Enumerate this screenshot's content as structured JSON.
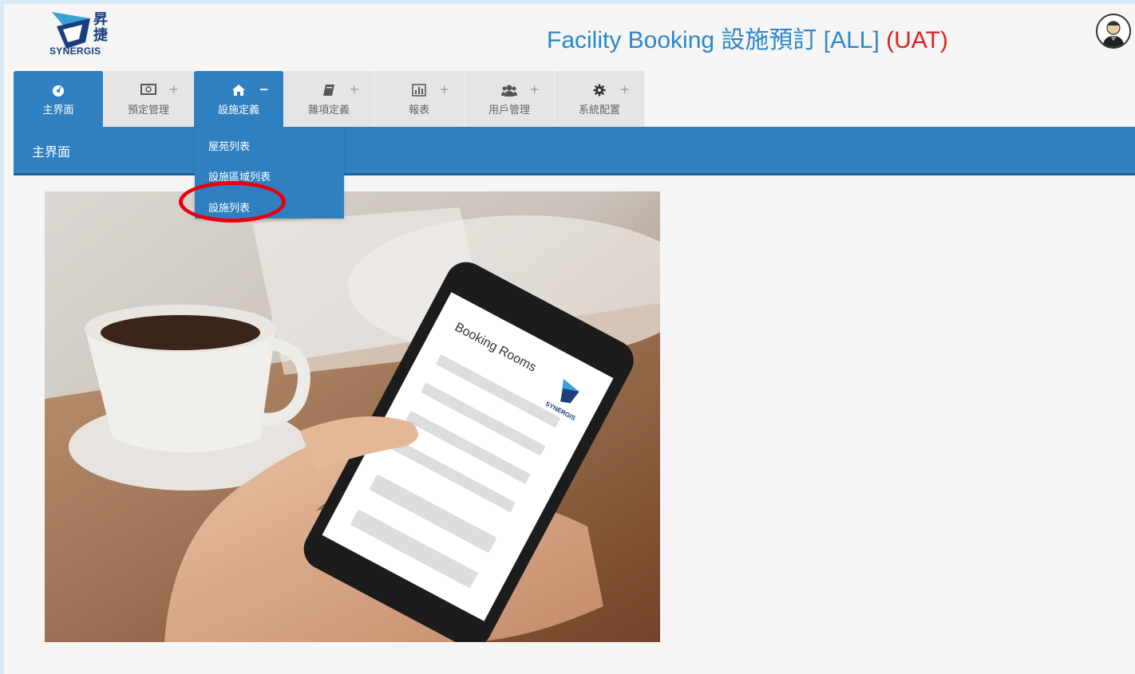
{
  "header": {
    "logo_cn": "昇捷",
    "logo_text": "SYNERGIS",
    "title_main": "Facility Booking 設施預訂 [ALL] ",
    "title_env": "(UAT)",
    "avatar_icon": "user-avatar-icon"
  },
  "tabs": [
    {
      "label": "主界面",
      "icon": "dashboard-icon",
      "toggle": "",
      "active": true
    },
    {
      "label": "預定管理",
      "icon": "money-icon",
      "toggle": "+",
      "active": false
    },
    {
      "label": "設施定義",
      "icon": "home-icon",
      "toggle": "−",
      "active": true
    },
    {
      "label": "雜項定義",
      "icon": "book-icon",
      "toggle": "+",
      "active": false
    },
    {
      "label": "報表",
      "icon": "bar-chart-icon",
      "toggle": "+",
      "active": false
    },
    {
      "label": "用戶管理",
      "icon": "users-icon",
      "toggle": "+",
      "active": false
    },
    {
      "label": "系統配置",
      "icon": "gear-icon",
      "toggle": "+",
      "active": false
    }
  ],
  "breadcrumb": "主界面",
  "dropdown": {
    "items": [
      "屋苑列表",
      "設施區域列表",
      "設施列表"
    ]
  },
  "hero": {
    "phone_title": "Booking Rooms",
    "phone_logo_text": "SYNERGIS"
  },
  "colors": {
    "primary": "#2f80c1",
    "title": "#2d87c7",
    "uat": "#e02020",
    "highlight": "#e8000f"
  }
}
